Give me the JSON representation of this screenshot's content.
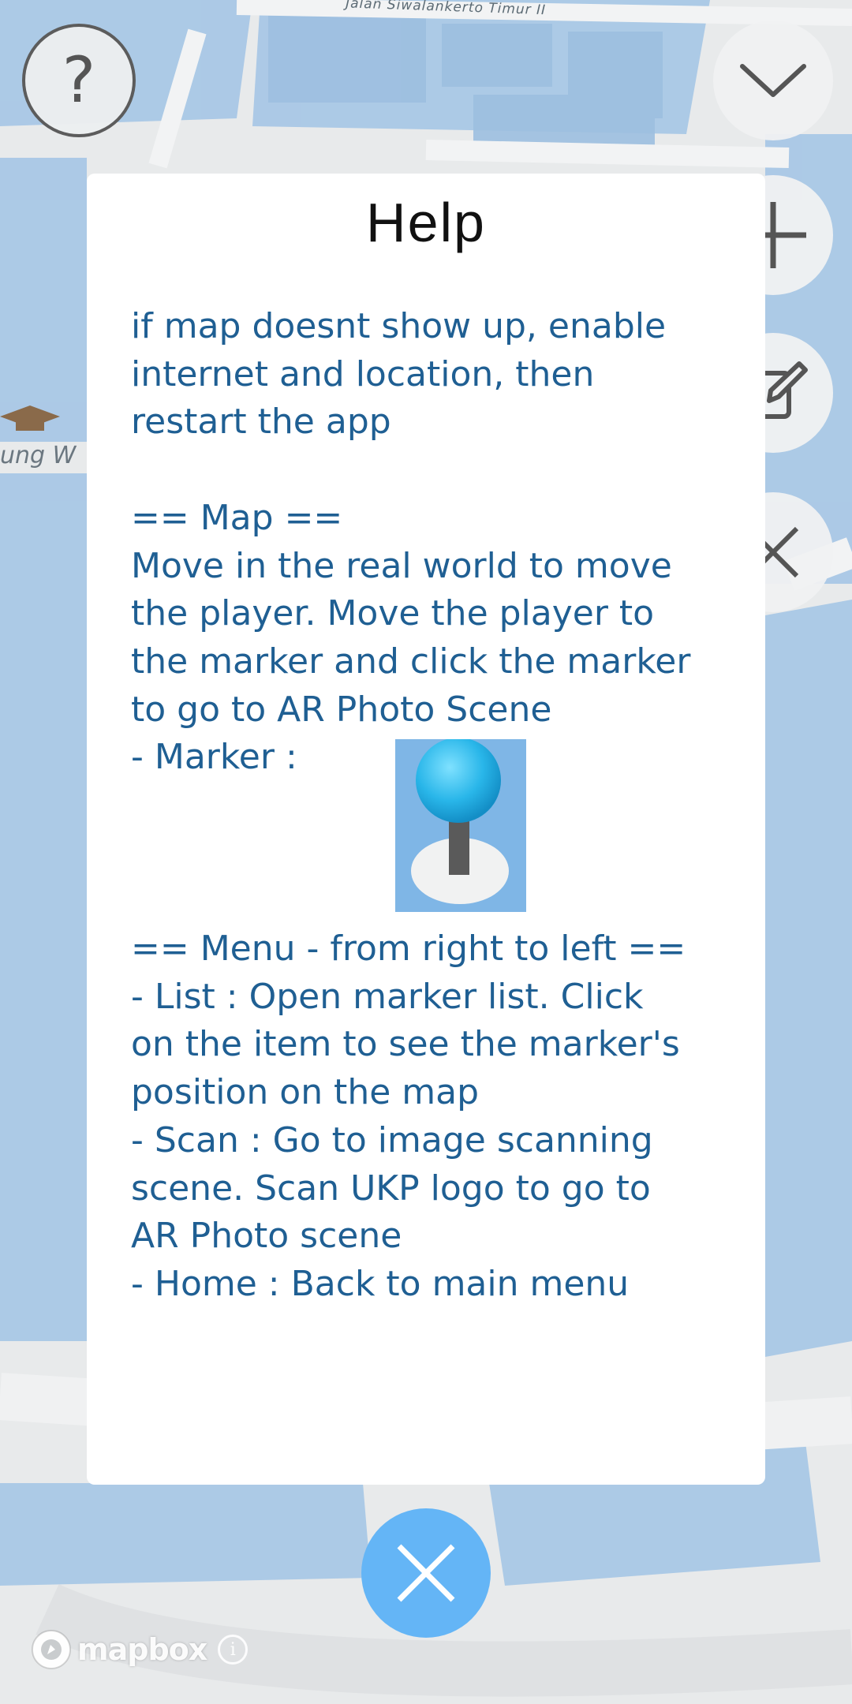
{
  "map": {
    "street_label": "Jalan Siwalankerto Timur II",
    "poi_label": "ung W"
  },
  "controls": {
    "help_glyph": "?",
    "collapse_icon": "chevron-down-icon",
    "add_icon": "plus-icon",
    "edit_icon": "edit-icon",
    "remove_icon": "close-icon",
    "menu_icon": "hamburger-menu-icon",
    "close_icon": "close-icon"
  },
  "help": {
    "title": "Help",
    "intro": "if map doesnt show up, enable\ninternet and location, then\nrestart the app",
    "map_section": "== Map ==\nMove in the real world to move\nthe player. Move the player to\nthe marker and click the marker\nto go to AR Photo Scene",
    "marker_label": "- Marker :",
    "menu_section": "== Menu - from right to left ==\n- List : Open marker list. Click\non the item to see the marker's\nposition on the map\n- Scan : Go to image scanning\nscene. Scan UKP logo to go to\nAR Photo scene\n- Home : Back to main menu"
  },
  "attribution": {
    "wordmark": "mapbox",
    "info_glyph": "i"
  },
  "colors": {
    "close_button": "#64b5f6",
    "help_text": "#1f5f93",
    "map_blocks": "#a9c8e6"
  }
}
